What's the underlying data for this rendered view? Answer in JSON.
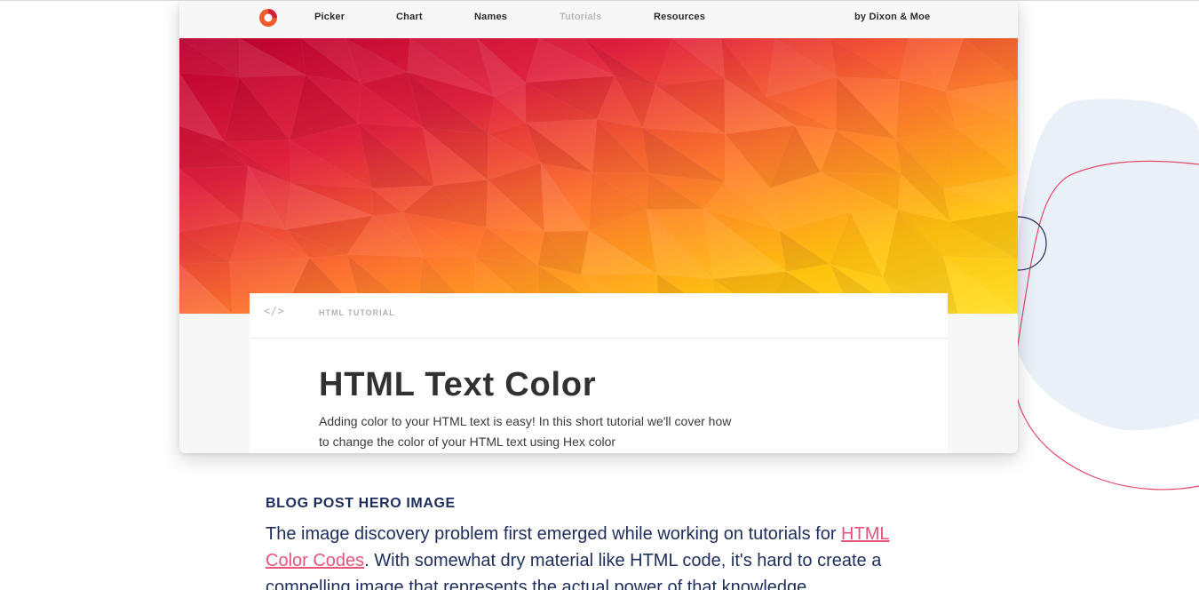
{
  "nav": {
    "items": [
      {
        "label": "Picker"
      },
      {
        "label": "Chart"
      },
      {
        "label": "Names"
      },
      {
        "label": "Tutorials"
      },
      {
        "label": "Resources"
      }
    ],
    "byline": "by Dixon & Moe",
    "active_item": "Tutorials"
  },
  "article": {
    "kicker": "HTML TUTORIAL",
    "code_icon": "</>",
    "title": "HTML Text Color",
    "intro": "Adding color to your HTML text is easy! In this short tutorial we'll cover how to change the color of your HTML text using Hex color"
  },
  "caption": {
    "heading": "BLOG POST HERO IMAGE",
    "body_before": "The image discovery problem first emerged while working on tutorials for ",
    "link_text": "HTML Color Codes",
    "body_after": ". With somewhat dry material like HTML code, it's hard to create a compelling image that represents the actual power of that knowledge."
  },
  "colors": {
    "navy": "#1e2e5c",
    "link_pink": "#e5567a",
    "logo_orange": "#ef5b2b",
    "logo_red": "#d41f3c",
    "hero_deep": "#b8002f",
    "hero_red": "#e0213f",
    "hero_orange": "#ff7a2e",
    "hero_yellow": "#ffe12a"
  },
  "icons": {
    "logo": "color-wheel-logo-icon",
    "code": "code-brackets-icon"
  }
}
